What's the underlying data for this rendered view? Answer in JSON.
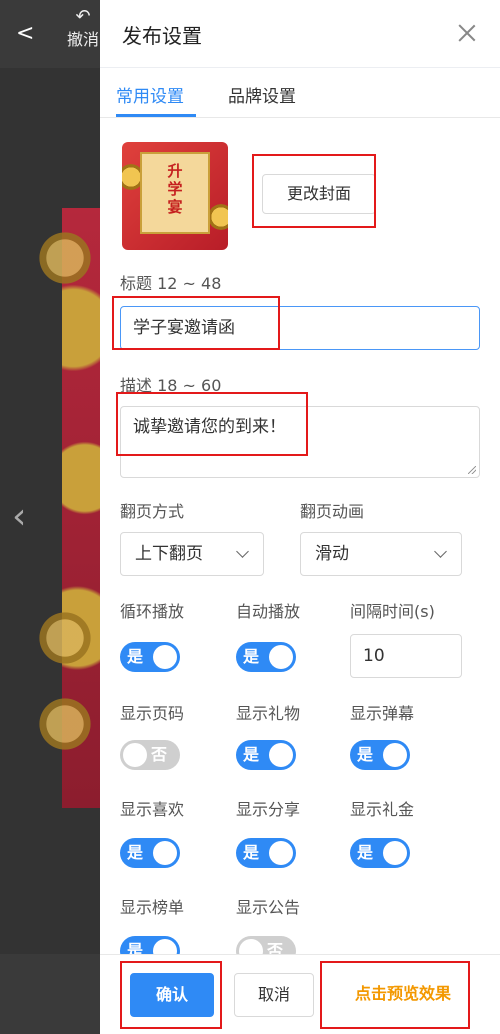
{
  "background": {
    "back_icon": "chevron-left-icon",
    "undo_label": "撤消",
    "nav_arrow": "chevron-left-icon"
  },
  "drawer": {
    "title": "发布设置",
    "close_icon": "close-icon"
  },
  "tabs": [
    {
      "label": "常用设置",
      "active": true
    },
    {
      "label": "品牌设置",
      "active": false
    }
  ],
  "cover": {
    "title_chars": [
      "升",
      "学",
      "宴"
    ],
    "change_button": "更改封面"
  },
  "title_field": {
    "label": "标题 12 ~ 48",
    "value": "学子宴邀请函"
  },
  "desc_field": {
    "label": "描述 18 ~ 60",
    "value": "诚挚邀请您的到来！"
  },
  "page_turn": {
    "label": "翻页方式",
    "value": "上下翻页"
  },
  "page_anim": {
    "label": "翻页动画",
    "value": "滑动"
  },
  "toggles": {
    "loop": {
      "label": "循环播放",
      "state": "是"
    },
    "autoplay": {
      "label": "自动播放",
      "state": "是"
    },
    "page_num": {
      "label": "显示页码",
      "state": "否"
    },
    "gifts": {
      "label": "显示礼物",
      "state": "是"
    },
    "danmaku": {
      "label": "显示弹幕",
      "state": "是"
    },
    "likes": {
      "label": "显示喜欢",
      "state": "是"
    },
    "share": {
      "label": "显示分享",
      "state": "是"
    },
    "cash_gift": {
      "label": "显示礼金",
      "state": "是"
    },
    "ranking": {
      "label": "显示榜单",
      "state": "是"
    },
    "notice": {
      "label": "显示公告",
      "state": "否"
    }
  },
  "interval": {
    "label": "间隔时间(s)",
    "value": "10"
  },
  "footer": {
    "confirm": "确认",
    "cancel": "取消",
    "preview": "点击预览效果"
  },
  "colors": {
    "accent": "#2f8af5",
    "preview": "#f39800",
    "highlight": "#e3191a"
  }
}
